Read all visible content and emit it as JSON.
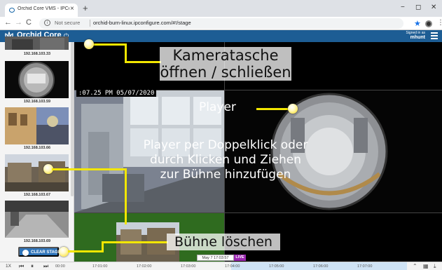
{
  "browser": {
    "tab_title": "Orchid Core VMS - IPConfigure",
    "tab_close": "×",
    "new_tab": "+",
    "minimize": "−",
    "maximize": "◻",
    "close": "✕",
    "back": "←",
    "forward": "→",
    "reload": "C",
    "not_secure": "Not secure",
    "url": "orchid-burn-linux.ipconfigure.com/#!/stage",
    "info_glyph": "i"
  },
  "app": {
    "brand": "Orchid Core",
    "signed_in_label": "Signed in as",
    "user": "mhunt"
  },
  "camera_bag": {
    "cameras": [
      {
        "label": "192.168.103.33"
      },
      {
        "label": "192.168.103.59"
      },
      {
        "label": "192.168.103.66"
      },
      {
        "label": "192.168.103.67"
      },
      {
        "label": "192.168.103.69"
      }
    ],
    "clear_stage": "CLEAR STAGE"
  },
  "stage": {
    "timestamp": ":07.25 PM 05/07/2020"
  },
  "annotations": {
    "bag_line1": "Kameratasche",
    "bag_line2": "öffnen / schließen",
    "player": "Player",
    "add_line1": "Player per Doppelklick oder",
    "add_line2": "durch Klicken und Ziehen",
    "add_line3": "zur Bühne hinzufügen",
    "clear": "Bühne löschen"
  },
  "timeline": {
    "speed": "1X",
    "ticks": [
      "00:00",
      "17:01:00",
      "17:02:00",
      "17:03:00",
      "17:04:00",
      "17:05:00",
      "17:06:00",
      "17:07:00"
    ],
    "cursor": "May 7 17:03:57",
    "live": "LIVE"
  },
  "icons": [
    "favicon-icon",
    "info-icon",
    "star-icon",
    "extension-icon",
    "kebab-icon",
    "orchid-logo-icon",
    "power-icon",
    "hamburger-icon",
    "clear-stage-icon",
    "skip-back-icon",
    "pause-icon",
    "skip-forward-icon",
    "chevron-up-icon",
    "calendar-icon",
    "download-icon"
  ],
  "colors": {
    "app_header": "#1d5d94",
    "clear_button": "#2d73b9",
    "annotation_line": "#f2e600",
    "live_badge": "#9b27b0",
    "live_range": "#cfe3f5"
  }
}
